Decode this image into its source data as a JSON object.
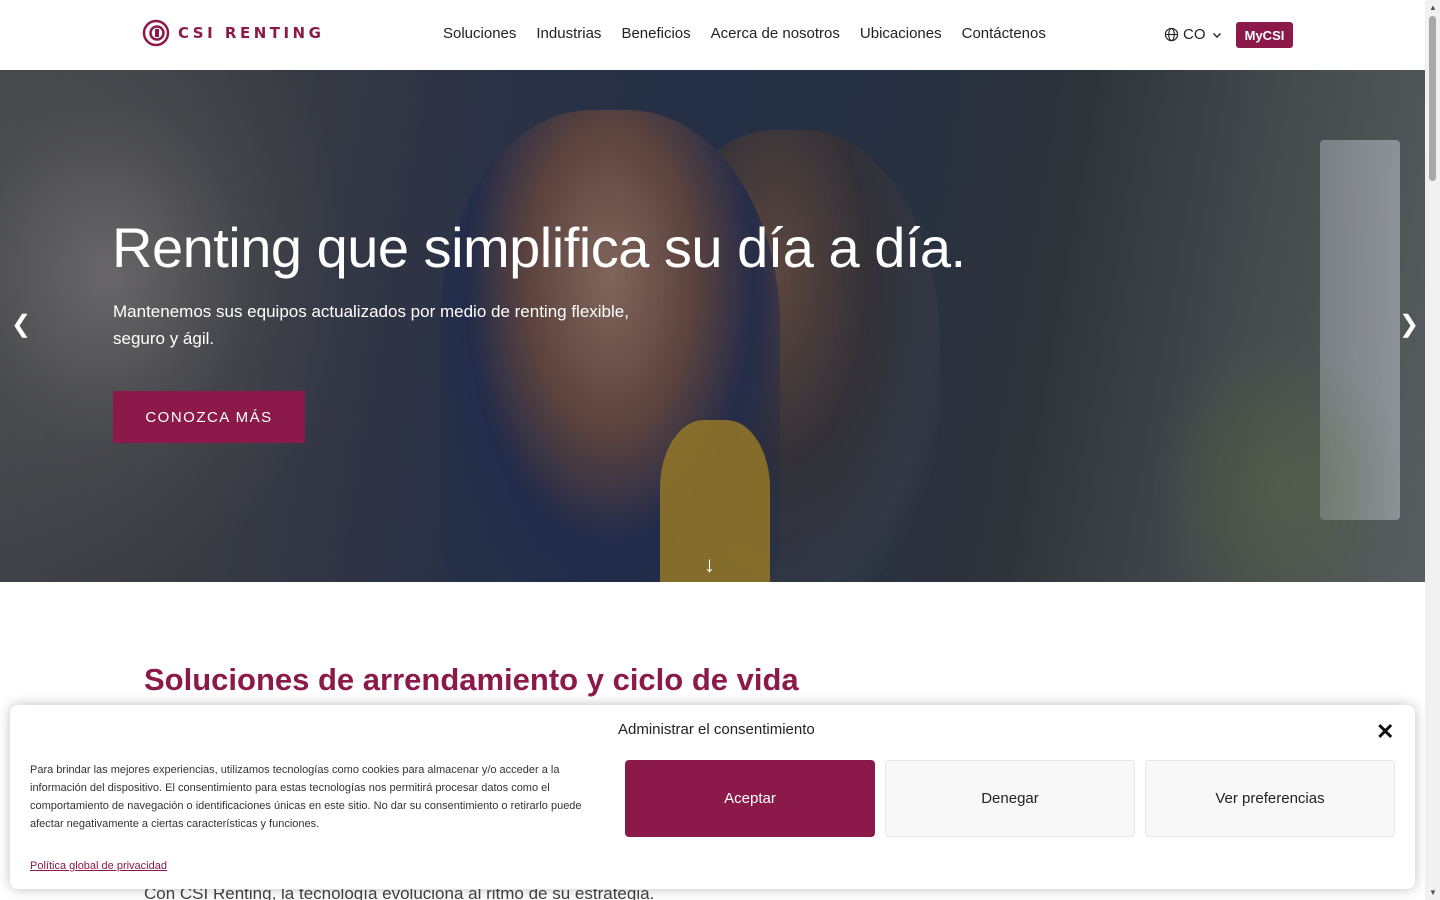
{
  "header": {
    "logo_text": "CSI RENTING",
    "nav": [
      "Soluciones",
      "Industrias",
      "Beneficios",
      "Acerca de nosotros",
      "Ubicaciones",
      "Contáctenos"
    ],
    "language": "CO",
    "account_button": "MyCSI"
  },
  "hero": {
    "title": "Renting que simplifica su día a día.",
    "subtitle": "Mantenemos sus equipos actualizados por medio de renting flexible, seguro y ágil.",
    "cta": "CONOZCA MÁS",
    "prev": "❮",
    "next": "❯",
    "scroll": "↓"
  },
  "section": {
    "title": "Soluciones de arrendamiento y ciclo de vida",
    "text": "Con CSI Renting, la tecnología evoluciona al ritmo de su estrategia."
  },
  "consent": {
    "title": "Administrar el consentimiento",
    "close": "✕",
    "text": "Para brindar las mejores experiencias, utilizamos tecnologías como cookies para almacenar y/o acceder a la información del dispositivo. El consentimiento para estas tecnologías nos permitirá procesar datos como el comportamiento de navegación o identificaciones únicas en este sitio. No dar su consentimiento o retirarlo puede afectar negativamente a ciertas características y funciones.",
    "privacy_link": "Política global de privacidad",
    "accept": "Aceptar",
    "deny": "Denegar",
    "preferences": "Ver preferencias"
  },
  "colors": {
    "brand": "#8b1a4a"
  }
}
